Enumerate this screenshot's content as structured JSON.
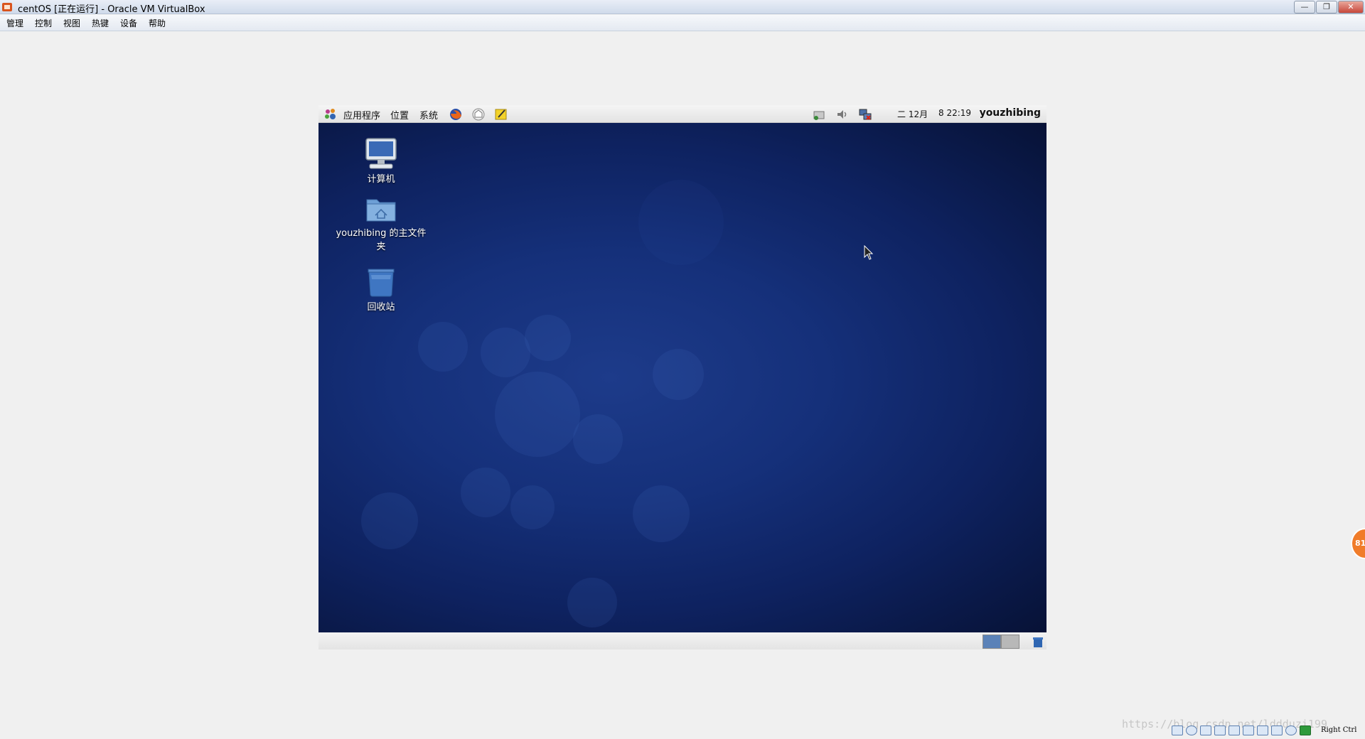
{
  "window": {
    "title": "centOS [正在运行] - Oracle VM VirtualBox",
    "minimize_label": "—",
    "maximize_label": "❐",
    "close_label": "✕"
  },
  "menu": {
    "items": [
      "管理",
      "控制",
      "视图",
      "热键",
      "设备",
      "帮助"
    ]
  },
  "guest_panel": {
    "applications": "应用程序",
    "places": "位置",
    "system": "系统",
    "date": "二 12月",
    "time": "8 22:19",
    "user": "youzhibing",
    "icons": [
      "firefox-icon",
      "mail-icon",
      "notes-icon",
      "network-icon",
      "volume-icon",
      "network-status-icon"
    ]
  },
  "desktop": {
    "icons": [
      {
        "label": "计算机",
        "icon": "computer-icon"
      },
      {
        "label": "youzhibing 的主文件夹",
        "icon": "home-folder-icon"
      },
      {
        "label": "回收站",
        "icon": "trash-icon"
      }
    ]
  },
  "bottom_panel": {
    "workspaces": 2
  },
  "status": {
    "watermark": "https://blog.csdn.net/lddduzi199",
    "host_key": "Right Ctrl",
    "badge": "81"
  },
  "colors": {
    "desktop_center": "#1d3b8a",
    "desktop_edge": "#071236",
    "panel_bg": "#ececec",
    "titlebar": "#dbe4f1"
  }
}
